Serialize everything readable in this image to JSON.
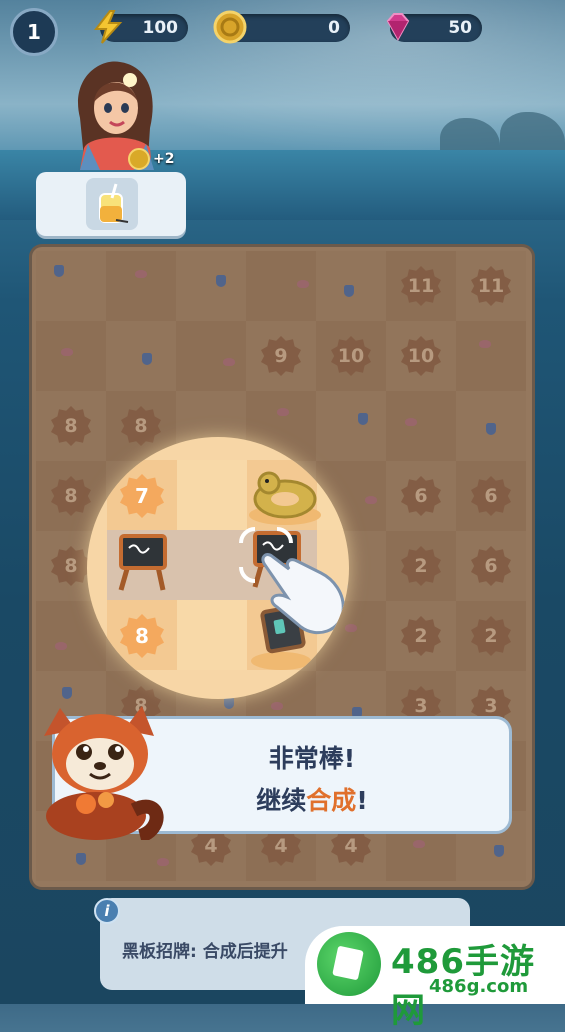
{
  "hud": {
    "level": "1",
    "energy": "100",
    "coins": "0",
    "gems": "50"
  },
  "order": {
    "reward": "+2"
  },
  "board": {
    "rows": [
      [
        "",
        "",
        "",
        "",
        "",
        "11",
        "11"
      ],
      [
        "",
        "",
        "",
        "9",
        "10",
        "10",
        ""
      ],
      [
        "8",
        "8",
        "",
        "",
        "",
        "",
        ""
      ],
      [
        "8",
        "",
        "",
        "",
        "",
        "6",
        "6"
      ],
      [
        "8",
        "",
        "",
        "",
        "",
        "2",
        "6"
      ],
      [
        "",
        "",
        "",
        "",
        "",
        "2",
        "2"
      ],
      [
        "",
        "8",
        "",
        "",
        "",
        "3",
        "3"
      ],
      [
        "",
        "",
        "",
        "",
        "",
        "",
        ""
      ],
      [
        "",
        "",
        "4",
        "4",
        "4",
        "",
        ""
      ]
    ],
    "spotlight_locks": [
      "7",
      "8"
    ]
  },
  "dialog": {
    "line1": "非常棒!",
    "line2_prefix": "继续",
    "line2_highlight": "合成",
    "line2_suffix": "!"
  },
  "info": {
    "text": "黑板招牌: 合成后提升"
  },
  "watermark": {
    "title": "486手游网",
    "url": "486g.com"
  },
  "colors": {
    "highlight": "#e0702c",
    "dialog_text": "#2d3d5c"
  }
}
